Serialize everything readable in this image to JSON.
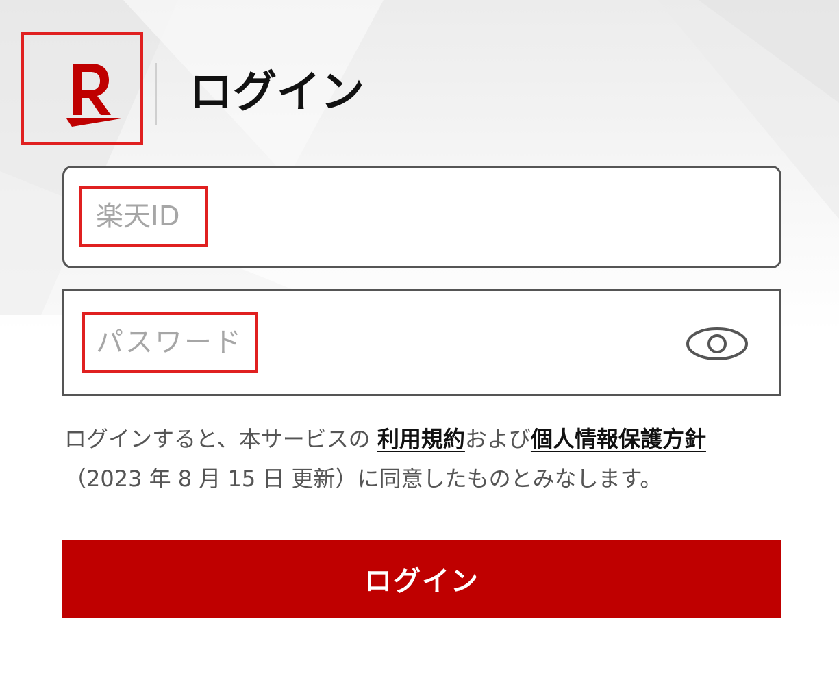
{
  "header": {
    "title": "ログイン"
  },
  "form": {
    "id_placeholder": "楽天ID",
    "password_placeholder": "パスワード",
    "submit_label": "ログイン"
  },
  "terms": {
    "prefix": "ログインすると、本サービスの",
    "terms_link": "利用規約",
    "conjunction": "および",
    "privacy_link": "個人情報保護方針",
    "date_note": "（2023 年 8 月 15 日 更新）",
    "suffix": "に同意したものとみなします。"
  },
  "colors": {
    "brand": "#bf0000",
    "highlight": "#e02020",
    "border": "#555555",
    "placeholder": "#a6a6a6"
  },
  "icons": {
    "logo": "rakuten-r-logo-icon",
    "password_toggle": "eye-icon"
  }
}
